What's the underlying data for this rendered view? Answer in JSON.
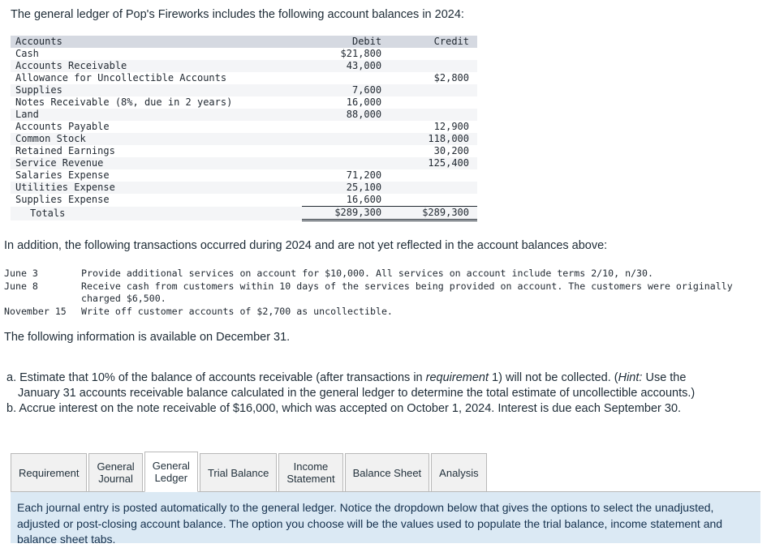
{
  "intro": {
    "top": "The general ledger of Pop's Fireworks includes the following account balances in 2024:",
    "middle": "In addition, the following transactions occurred during 2024 and are not yet reflected in the account balances above:",
    "dec31": "The following information is available on December 31."
  },
  "ledger": {
    "columns": [
      "Accounts",
      "Debit",
      "Credit"
    ],
    "rows": [
      {
        "account": "Cash",
        "debit": "$21,800",
        "credit": ""
      },
      {
        "account": "Accounts Receivable",
        "debit": "43,000",
        "credit": ""
      },
      {
        "account": "Allowance for Uncollectible Accounts",
        "debit": "",
        "credit": "$2,800"
      },
      {
        "account": "Supplies",
        "debit": "7,600",
        "credit": ""
      },
      {
        "account": "Notes Receivable (8%, due in 2 years)",
        "debit": "16,000",
        "credit": ""
      },
      {
        "account": "Land",
        "debit": "88,000",
        "credit": ""
      },
      {
        "account": "Accounts Payable",
        "debit": "",
        "credit": "12,900"
      },
      {
        "account": "Common Stock",
        "debit": "",
        "credit": "118,000"
      },
      {
        "account": "Retained Earnings",
        "debit": "",
        "credit": "30,200"
      },
      {
        "account": "Service Revenue",
        "debit": "",
        "credit": "125,400"
      },
      {
        "account": "Salaries Expense",
        "debit": "71,200",
        "credit": ""
      },
      {
        "account": "Utilities Expense",
        "debit": "25,100",
        "credit": ""
      },
      {
        "account": "Supplies Expense",
        "debit": "16,600",
        "credit": ""
      }
    ],
    "totals": {
      "label": "Totals",
      "debit": "$289,300",
      "credit": "$289,300"
    }
  },
  "transactions": [
    {
      "date": "June 3",
      "desc": "Provide additional services on account for $10,000. All services on account include terms 2/10, n/30.",
      "cont": ""
    },
    {
      "date": "June 8",
      "desc": "Receive cash from customers within 10 days of the services being provided on account. The customers were originally",
      "cont": "charged $6,500."
    },
    {
      "date": "November 15",
      "desc": "Write off customer accounts of $2,700 as uncollectible.",
      "cont": ""
    }
  ],
  "requirements": {
    "a_part1": "a. Estimate that 10% of the balance of accounts receivable (after transactions in ",
    "a_italic1": "requirement",
    "a_part2": " 1) will not be collected. (",
    "a_italic2": "Hint:",
    "a_part3": " Use the",
    "a_line2": "January 31 accounts receivable balance calculated in the general ledger to determine the total estimate of uncollectible accounts.)",
    "b_line": "b. Accrue interest on the note receivable of $16,000, which was accepted on October 1, 2024. Interest is due each September 30."
  },
  "tabs": [
    {
      "label": "Requirement",
      "line1": "Requirement",
      "line2": "",
      "active": false
    },
    {
      "label": "General Journal",
      "line1": "General",
      "line2": "Journal",
      "active": false
    },
    {
      "label": "General Ledger",
      "line1": "General",
      "line2": "Ledger",
      "active": true
    },
    {
      "label": "Trial Balance",
      "line1": "Trial Balance",
      "line2": "",
      "active": false
    },
    {
      "label": "Income Statement",
      "line1": "Income",
      "line2": "Statement",
      "active": false
    },
    {
      "label": "Balance Sheet",
      "line1": "Balance Sheet",
      "line2": "",
      "active": false
    },
    {
      "label": "Analysis",
      "line1": "Analysis",
      "line2": "",
      "active": false
    }
  ],
  "info_panel": {
    "text": "Each journal entry is posted automatically to the general ledger. Notice the dropdown below that gives the options to select the unadjusted, adjusted or post-closing account balance.  The option you choose will be the values used to populate the trial balance, income statement and balance sheet tabs."
  },
  "colors": {
    "header_row": "#d5d9e1",
    "stripe": "#f4f5f7",
    "info_panel_bg": "#dbe9f4",
    "info_panel_text": "#14304d",
    "tab_inactive": "#f1f1f1",
    "tab_active": "#ffffff",
    "border": "#b8b8b8"
  }
}
